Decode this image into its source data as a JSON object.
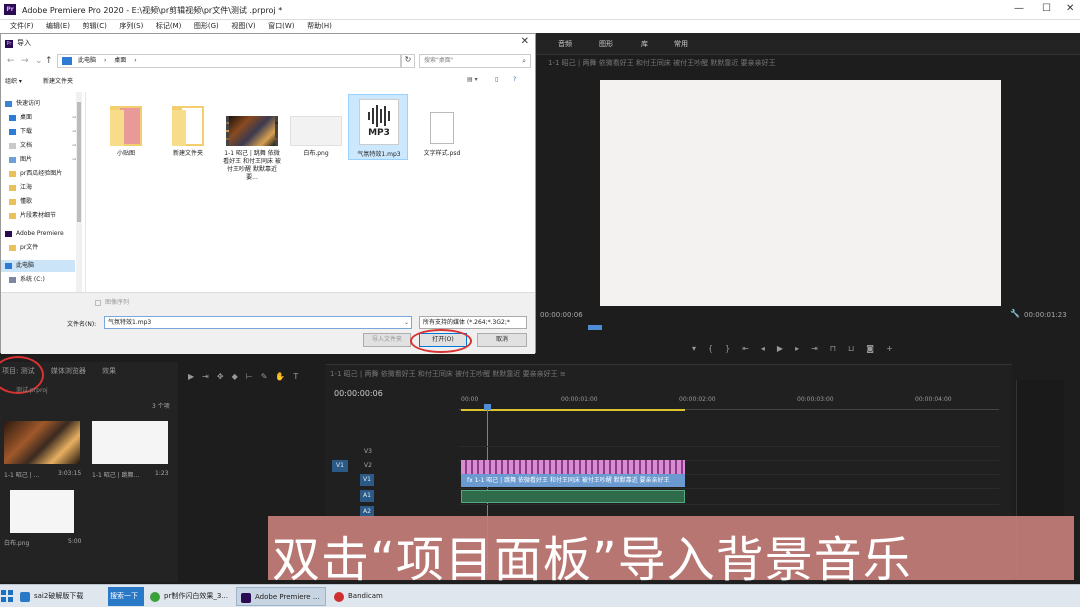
{
  "app": {
    "title": "Adobe Premiere Pro 2020 - E:\\视频\\pr剪辑视频\\pr文件\\测试 .prproj *",
    "logo": "Pr",
    "menu": [
      "文件(F)",
      "编辑(E)",
      "剪辑(C)",
      "序列(S)",
      "标记(M)",
      "图形(G)",
      "视图(V)",
      "窗口(W)",
      "帮助(H)"
    ]
  },
  "workspaces": [
    "音频",
    "图形",
    "库",
    "常用"
  ],
  "program_monitor": {
    "title": "1-1 昭己 | 两舞 依微看好王 和付王同床 被付王吵醒 默默靠近 要亲亲好王",
    "timecode_left": "00:00:00:06",
    "timecode_right": "00:00:01:23"
  },
  "dialog": {
    "title": "导入",
    "icon": "Pr",
    "close": "✕",
    "breadcrumb": [
      "此电脑",
      "桌面"
    ],
    "search_placeholder": "搜索\"桌面\"",
    "organize": "组织 ▾",
    "new_folder": "新建文件夹",
    "nav_items": [
      {
        "label": "快速访问",
        "icon": "star-icon"
      },
      {
        "label": "桌面",
        "icon": "desktop-icon"
      },
      {
        "label": "下载",
        "icon": "download-icon"
      },
      {
        "label": "文档",
        "icon": "document-icon"
      },
      {
        "label": "图片",
        "icon": "picture-icon"
      },
      {
        "label": "pr西瓜经验图片",
        "icon": "folder-icon"
      },
      {
        "label": "江海",
        "icon": "folder-icon"
      },
      {
        "label": "懂歌",
        "icon": "folder-icon"
      },
      {
        "label": "片段素材细节",
        "icon": "folder-icon"
      },
      {
        "label": "Adobe Premiere",
        "icon": "premiere-icon"
      },
      {
        "label": "pr文件",
        "icon": "folder-icon"
      },
      {
        "label": "此电脑",
        "icon": "computer-icon"
      },
      {
        "label": "系统 (C:)",
        "icon": "drive-icon"
      }
    ],
    "files": [
      {
        "name": "小贴图",
        "type": "folder"
      },
      {
        "name": "新建文件夹",
        "type": "folder"
      },
      {
        "name": "1-1 昭己 | 跳舞 依微看好王 和付王同床 被付王吵醒 默默靠近 要...",
        "type": "video"
      },
      {
        "name": "白布.png",
        "type": "image"
      },
      {
        "name": "气氛特效1.mp3",
        "type": "mp3",
        "badge": "MP3"
      },
      {
        "name": "文字样式.psd",
        "type": "doc"
      }
    ],
    "preview_label": "图像序列",
    "filename_label": "文件名(N):",
    "filename_value": "气氛特效1.mp3",
    "filetype_value": "所有支持的媒体 (*.264;*.3G2;*",
    "import_folder": "导入文件夹",
    "open": "打开(O)",
    "cancel": "取消"
  },
  "project": {
    "tabs": [
      "项目: 测试",
      "媒体浏览器",
      "效果"
    ],
    "file": "测试.prproj",
    "count": "3 个项",
    "items": [
      {
        "name": "1-1 昭己 | ...",
        "duration": "3:03:15"
      },
      {
        "name": "1-1 昭己 | 跳舞...",
        "duration": "1:23"
      },
      {
        "name": "白布.png",
        "duration": "5:00"
      }
    ]
  },
  "timeline": {
    "title": "1-1 昭己 | 两舞 依微看好王 和付王同床 被付王吵醒 默默靠近 要亲亲好王 ≡",
    "timecode": "00:00:00:06",
    "ruler": [
      "00:00",
      "00:00:01:00",
      "00:00:02:00",
      "00:00:03:00",
      "00:00:04:00"
    ],
    "tracks": [
      "V3",
      "V2",
      "V1",
      "A1",
      "A2"
    ],
    "v1_clip": "fx  1-1 昭己 | 跳舞 依微看好王 和付王同床 被付王吵醒 默默靠近 要亲亲好王"
  },
  "subtitle": "双击“项目面板”导入背景音乐",
  "taskbar": [
    {
      "label": "sai2破解版下载",
      "icon_color": "#2a78c8"
    },
    {
      "label": "搜索一下",
      "icon_color": "#2a78c8"
    },
    {
      "label": "pr制作闪白效果_3...",
      "icon_color": "#3aa13a"
    },
    {
      "label": "Adobe Premiere ...",
      "icon_color": "#2a0a52"
    },
    {
      "label": "Bandicam",
      "icon_color": "#d03030"
    }
  ],
  "colors": {
    "accent": "#2c5a86",
    "subtitle_bg": "#c47e78",
    "playhead": "#4f8cd6",
    "v2_clip": "#d88cd1"
  }
}
